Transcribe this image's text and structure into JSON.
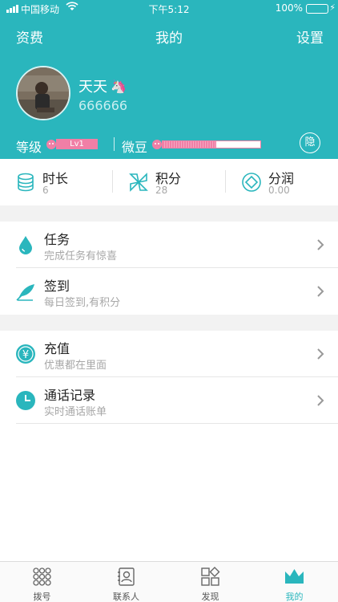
{
  "status_bar": {
    "carrier": "中国移动",
    "time": "下午5:12",
    "battery_percent": "100%"
  },
  "nav": {
    "left": "资费",
    "title": "我的",
    "right": "设置"
  },
  "profile": {
    "name": "天天",
    "name_emoji": "🦄",
    "id": "666666"
  },
  "level": {
    "label": "等级",
    "badge": "Lv1",
    "bean_label": "微豆",
    "bean_progress": 0.55,
    "hide_button": "隐"
  },
  "stats": [
    {
      "icon": "database-icon",
      "name": "时长",
      "value": "6"
    },
    {
      "icon": "pinwheel-icon",
      "name": "积分",
      "value": "28"
    },
    {
      "icon": "diamond-coin-icon",
      "name": "分润",
      "value": "0.00"
    }
  ],
  "menu_group1": [
    {
      "icon": "drop-icon",
      "title": "任务",
      "subtitle": "完成任务有惊喜"
    },
    {
      "icon": "feather-icon",
      "title": "签到",
      "subtitle": "每日签到,有积分"
    }
  ],
  "menu_group2": [
    {
      "icon": "yen-icon",
      "title": "充值",
      "subtitle": "优惠都在里面"
    },
    {
      "icon": "clock-icon",
      "title": "通话记录",
      "subtitle": "实时通话账单"
    }
  ],
  "tabbar": [
    {
      "icon": "dialpad-icon",
      "label": "拨号"
    },
    {
      "icon": "contacts-icon",
      "label": "联系人"
    },
    {
      "icon": "discover-icon",
      "label": "发现"
    },
    {
      "icon": "crown-icon",
      "label": "我的"
    }
  ],
  "colors": {
    "accent": "#2ab6bd",
    "pink": "#f07fa6",
    "battery": "#6fe36d"
  }
}
